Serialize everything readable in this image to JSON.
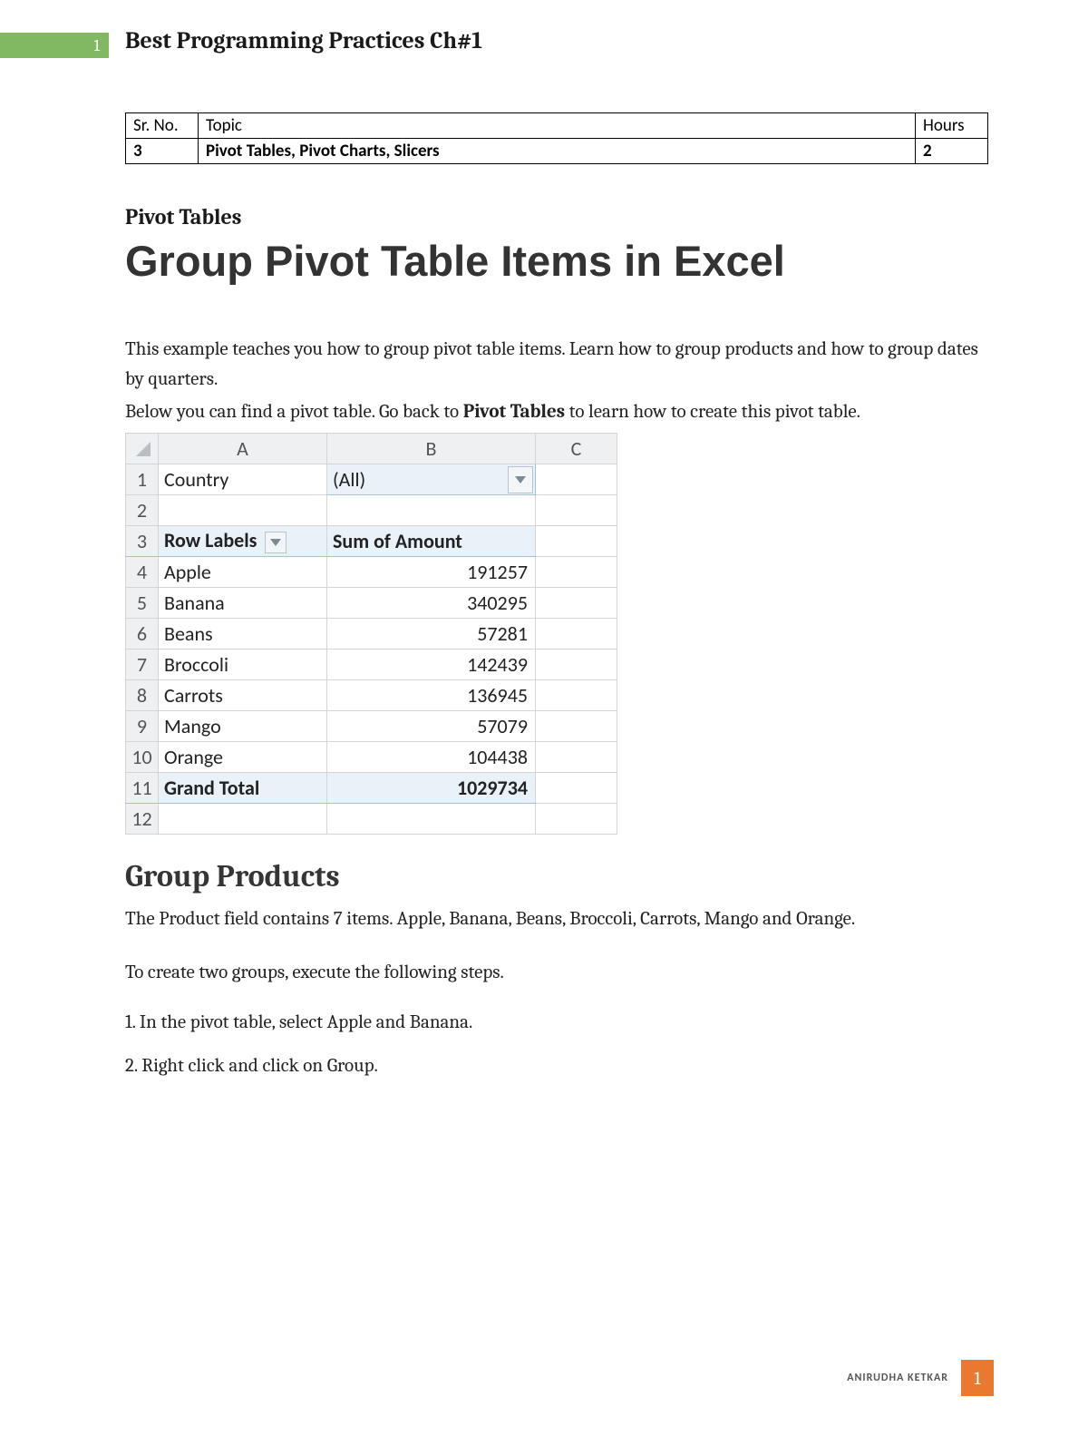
{
  "header": {
    "page_num_top": "1",
    "chapter_title": "Best Programming Practices Ch#1"
  },
  "topic_table": {
    "headers": {
      "sr": "Sr. No.",
      "topic": "Topic",
      "hours": "Hours"
    },
    "row": {
      "sr": "3",
      "topic": "Pivot Tables, Pivot Charts, Slicers",
      "hours": "2"
    }
  },
  "section_label": "Pivot Tables",
  "main_title": "Group Pivot Table Items in Excel",
  "intro_p1": "This example teaches you how to group pivot table items. Learn how to group products and how to group dates by quarters.",
  "intro_p2_pre": "Below you can find a pivot table. Go back to ",
  "intro_p2_bold": "Pivot Tables",
  "intro_p2_post": " to learn how to create this pivot table.",
  "excel": {
    "col_headers": [
      "A",
      "B",
      "C"
    ],
    "rows": [
      {
        "n": "1",
        "a": "Country",
        "b": "(All)",
        "filter": true
      },
      {
        "n": "2",
        "a": "",
        "b": ""
      },
      {
        "n": "3",
        "a": "Row Labels",
        "b": "Sum of Amount",
        "pthdr": true
      },
      {
        "n": "4",
        "a": "Apple",
        "b": "191257"
      },
      {
        "n": "5",
        "a": "Banana",
        "b": "340295"
      },
      {
        "n": "6",
        "a": "Beans",
        "b": "57281"
      },
      {
        "n": "7",
        "a": "Broccoli",
        "b": "142439"
      },
      {
        "n": "8",
        "a": "Carrots",
        "b": "136945"
      },
      {
        "n": "9",
        "a": "Mango",
        "b": "57079"
      },
      {
        "n": "10",
        "a": "Orange",
        "b": "104438"
      },
      {
        "n": "11",
        "a": "Grand Total",
        "b": "1029734",
        "grand": true
      },
      {
        "n": "12",
        "a": "",
        "b": ""
      }
    ]
  },
  "h2": "Group Products",
  "gp_intro": "The Product field contains 7 items. Apple, Banana, Beans, Broccoli, Carrots, Mango and Orange.",
  "gp_lead": "To create two groups, execute the following steps.",
  "step1": "1. In the pivot table, select Apple and Banana.",
  "step2": "2. Right click and click on Group.",
  "footer": {
    "author": "ANIRUDHA KETKAR",
    "page": "1"
  }
}
